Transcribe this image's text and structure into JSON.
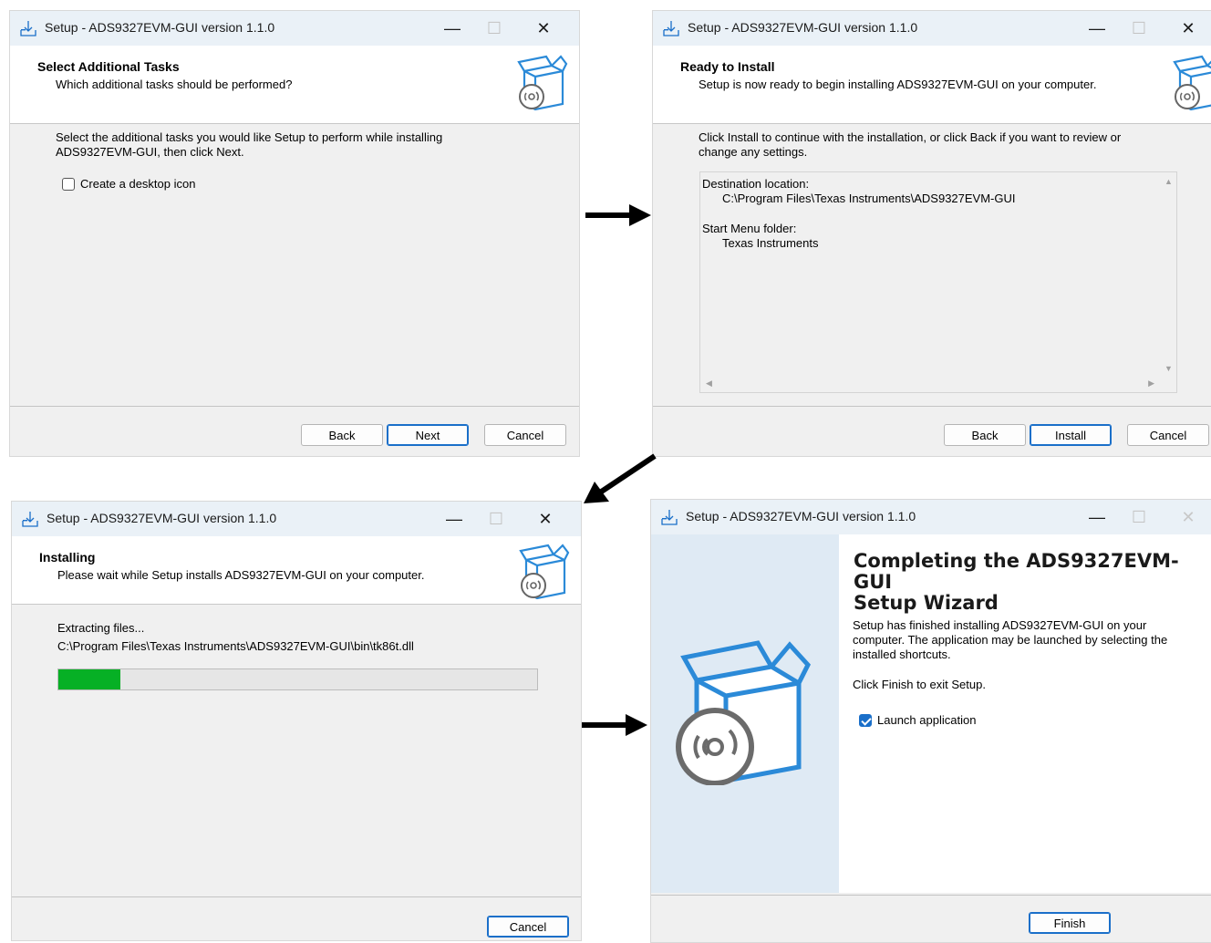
{
  "colors": {
    "accent": "#1a6fc9",
    "progress": "#06b025",
    "header_bg": "#ffffff",
    "panel_bg": "#f0f0f0",
    "side_panel": "#dfeaf4"
  },
  "icons": {
    "app": "download-tray-icon",
    "setup": "box-with-cd-icon",
    "arrow": "black-arrow-icon"
  },
  "windows": [
    {
      "title": "Setup - ADS9327EVM-GUI version 1.1.0",
      "heading": "Select Additional Tasks",
      "subheading": "Which additional tasks should be performed?",
      "intro_line1": "Select the additional tasks you would like Setup to perform while installing",
      "intro_line2": "ADS9327EVM-GUI, then click Next.",
      "checkbox_label": "Create a desktop icon",
      "checkbox_checked": false,
      "buttons": {
        "back": "Back",
        "next": "Next",
        "cancel": "Cancel"
      }
    },
    {
      "title": "Setup - ADS9327EVM-GUI version 1.1.0",
      "heading": "Ready to Install",
      "subheading": "Setup is now ready to begin installing ADS9327EVM-GUI on your computer.",
      "intro_line1": "Click Install to continue with the installation, or click Back if you want to review or",
      "intro_line2": "change any settings.",
      "memo": {
        "dest_label": "Destination location:",
        "dest_value": "C:\\Program Files\\Texas Instruments\\ADS9327EVM-GUI",
        "menu_label": "Start Menu folder:",
        "menu_value": "Texas Instruments"
      },
      "buttons": {
        "back": "Back",
        "install": "Install",
        "cancel": "Cancel"
      }
    },
    {
      "title": "Setup - ADS9327EVM-GUI version 1.1.0",
      "heading": "Installing",
      "subheading": "Please wait while Setup installs ADS9327EVM-GUI on your computer.",
      "status": "Extracting files...",
      "file": "C:\\Program Files\\Texas Instruments\\ADS9327EVM-GUI\\bin\\tk86t.dll",
      "progress": 0.13,
      "buttons": {
        "cancel": "Cancel"
      }
    },
    {
      "title": "Setup - ADS9327EVM-GUI version 1.1.0",
      "big_title_line1": "Completing the ADS9327EVM-GUI",
      "big_title_line2": "Setup Wizard",
      "text_line1": "Setup has finished installing ADS9327EVM-GUI on your",
      "text_line2": "computer. The application may be launched by selecting the",
      "text_line3": "installed shortcuts.",
      "exit_text": "Click Finish to exit Setup.",
      "checkbox_label": "Launch application",
      "checkbox_checked": true,
      "buttons": {
        "finish": "Finish"
      }
    }
  ]
}
